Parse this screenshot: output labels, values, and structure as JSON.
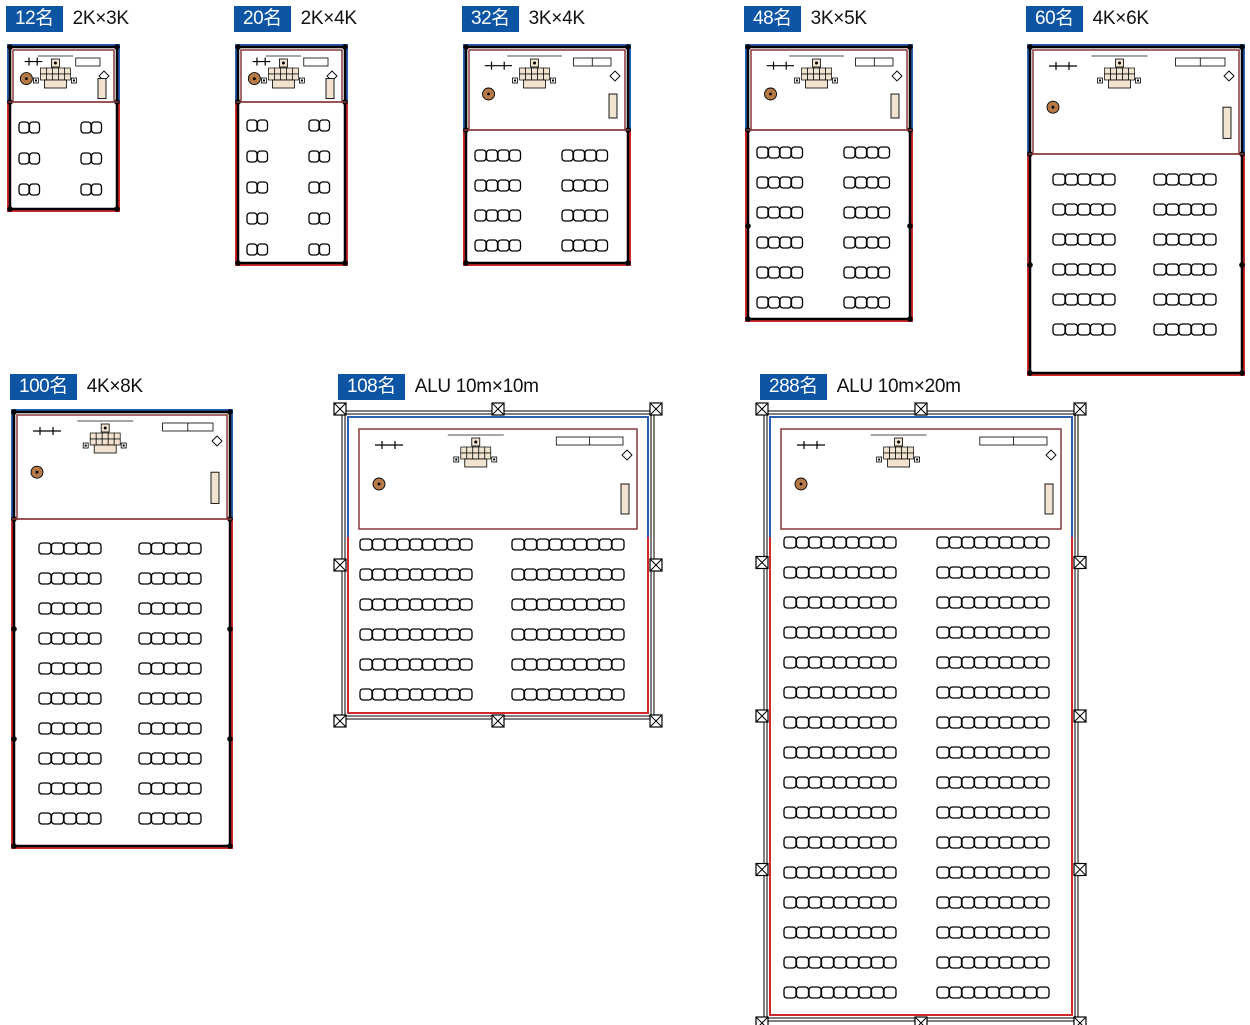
{
  "colors": {
    "badge_bg": "#0b55a4",
    "badge_text": "#ffffff",
    "wall_front": "#2b5fb3",
    "wall_sides": "#d22a2a",
    "stage_border": "#8a3a3a",
    "frame": "#000000",
    "furniture_fill": "#f1e3d0",
    "podium_fill": "#b57a48"
  },
  "plans": [
    {
      "capacity": "12名",
      "size": "2K×3K",
      "seat_rows": 3,
      "seats_per_block": 2,
      "frame": "tent"
    },
    {
      "capacity": "20名",
      "size": "2K×4K",
      "seat_rows": 5,
      "seats_per_block": 2,
      "frame": "tent"
    },
    {
      "capacity": "32名",
      "size": "3K×4K",
      "seat_rows": 4,
      "seats_per_block": 4,
      "frame": "tent"
    },
    {
      "capacity": "48名",
      "size": "3K×5K",
      "seat_rows": 6,
      "seats_per_block": 4,
      "frame": "tent"
    },
    {
      "capacity": "60名",
      "size": "4K×6K",
      "seat_rows": 6,
      "seats_per_block": 5,
      "frame": "tent"
    },
    {
      "capacity": "100名",
      "size": "4K×8K",
      "seat_rows": 10,
      "seats_per_block": 5,
      "frame": "tent"
    },
    {
      "capacity": "108名",
      "size": "ALU 10m×10m",
      "seat_rows": 6,
      "seats_per_block": 9,
      "frame": "alu"
    },
    {
      "capacity": "288名",
      "size": "ALU 10m×20m",
      "seat_rows": 16,
      "seats_per_block": 9,
      "frame": "alu"
    }
  ]
}
